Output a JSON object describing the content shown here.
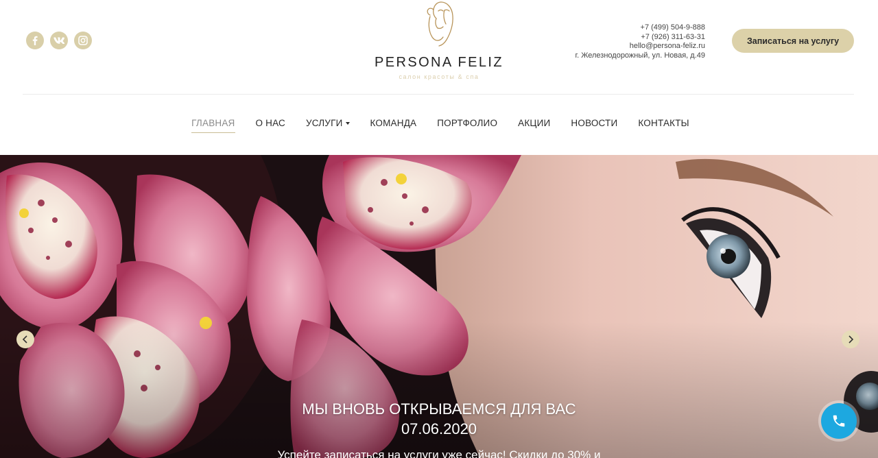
{
  "brand": {
    "name": "PERSONA FELIZ",
    "tagline": "салон красоты & спа",
    "accent_color": "#dcd1a9"
  },
  "social": [
    {
      "icon": "facebook-icon"
    },
    {
      "icon": "vk-icon"
    },
    {
      "icon": "instagram-icon"
    }
  ],
  "contacts": {
    "phone1": "+7 (499) 504-9-888",
    "phone2": "+7 (926) 311-63-31",
    "email": "hello@persona-feliz.ru",
    "address": "г. Железнодорожный, ул. Новая, д.49"
  },
  "cta_label": "Записаться на услугу",
  "nav": {
    "items": [
      {
        "label": "ГЛАВНАЯ"
      },
      {
        "label": "О НАС"
      },
      {
        "label": "УСЛУГИ"
      },
      {
        "label": "КОМАНДА"
      },
      {
        "label": "ПОРТФОЛИО"
      },
      {
        "label": "АКЦИИ"
      },
      {
        "label": "НОВОСТИ"
      },
      {
        "label": "КОНТАКТЫ"
      }
    ],
    "active": "ГЛАВНАЯ"
  },
  "hero": {
    "title_line1": "МЫ ВНОВЬ ОТКРЫВАЕМСЯ ДЛЯ ВАС",
    "title_line2": "07.06.2020",
    "subtitle": "Успейте записаться на услуги уже сейчас! Скидки до 30% и"
  },
  "call_button_color": "#1da8e0"
}
